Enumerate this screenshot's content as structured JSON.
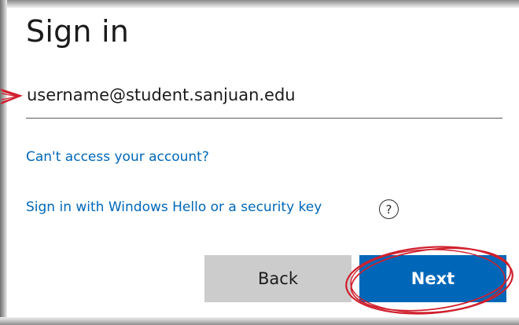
{
  "title": "Sign in",
  "email": {
    "value": "username@student.sanjuan.edu"
  },
  "links": {
    "cant_access": "Can't access your account?",
    "windows_hello": "Sign in with Windows Hello or a security key"
  },
  "help_icon": {
    "icon": "question-circle-icon",
    "glyph": "?"
  },
  "buttons": {
    "back": "Back",
    "next": "Next"
  },
  "colors": {
    "link": "#0067b8",
    "primary_button": "#0067b8",
    "secondary_button": "#cccccc",
    "annotation": "#d0202e"
  }
}
